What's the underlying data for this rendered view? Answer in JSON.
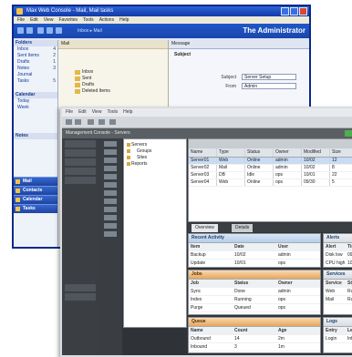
{
  "back_window": {
    "title": "Max Web Console - Mail, Mail tasks",
    "menu": [
      "File",
      "Edit",
      "View",
      "Favorites",
      "Tools",
      "Actions",
      "Help"
    ],
    "breadcrumb": "Inbox ▸ Mail",
    "brand": "The Administrator",
    "nav": {
      "header": "Folders",
      "rows": [
        {
          "label": "Inbox",
          "count": "4"
        },
        {
          "label": "Sent Items",
          "count": "2"
        },
        {
          "label": "Drafts",
          "count": "1"
        },
        {
          "label": "Notes",
          "count": "3"
        },
        {
          "label": "Journal",
          "count": ""
        },
        {
          "label": "Tasks",
          "count": "5"
        }
      ],
      "section2_header": "Calendar",
      "section2_rows": [
        "Today",
        "Week"
      ],
      "section3_header": "Notes",
      "buttons": [
        "Mail",
        "Contacts",
        "Calendar",
        "Tasks"
      ]
    },
    "mid": {
      "header": "Mail",
      "folders": [
        "Inbox",
        "Sent",
        "Drafts",
        "Deleted Items"
      ]
    },
    "right": {
      "header": "Message",
      "toolbar_label": "Subject",
      "fields": [
        {
          "label": "Subject",
          "value": "Server Setup"
        },
        {
          "label": "From",
          "value": "Admin"
        }
      ]
    }
  },
  "front_window": {
    "menu": [
      "File",
      "Edit",
      "View",
      "Tools",
      "Help"
    ],
    "address": "Management Console - Servers",
    "tree": [
      "Servers",
      "Groups",
      "Sites",
      "Reports"
    ],
    "detail_columns": [
      "Name",
      "Type",
      "Status",
      "Owner",
      "Modified",
      "Size"
    ],
    "detail_rows": [
      [
        "Server01",
        "Web",
        "Online",
        "admin",
        "10/02",
        "12"
      ],
      [
        "Server02",
        "Mail",
        "Online",
        "admin",
        "10/02",
        "8"
      ],
      [
        "Server03",
        "DB",
        "Idle",
        "ops",
        "10/01",
        "22"
      ],
      [
        "Server04",
        "Web",
        "Online",
        "ops",
        "09/30",
        "5"
      ]
    ],
    "tabs": [
      "Overview",
      "Details"
    ],
    "panels": [
      {
        "title": "Recent Activity",
        "rows": [
          [
            "Item",
            "Date",
            "User"
          ],
          [
            "Backup",
            "10/02",
            "admin"
          ],
          [
            "Update",
            "10/01",
            "ops"
          ]
        ]
      },
      {
        "title": "Alerts",
        "rows": [
          [
            "Alert",
            "Time"
          ],
          [
            "Disk low",
            "09:12"
          ],
          [
            "CPU high",
            "10:40"
          ]
        ]
      },
      {
        "title": "Jobs",
        "rows": [
          [
            "Job",
            "Status",
            "Owner"
          ],
          [
            "Sync",
            "Done",
            "admin"
          ],
          [
            "Index",
            "Running",
            "ops"
          ],
          [
            "Purge",
            "Queued",
            "ops"
          ]
        ]
      },
      {
        "title": "Services",
        "rows": [
          [
            "Service",
            "State"
          ],
          [
            "Web",
            "Running"
          ],
          [
            "Mail",
            "Running"
          ]
        ]
      },
      {
        "title": "Queue",
        "rows": [
          [
            "Name",
            "Count",
            "Age"
          ],
          [
            "Outbound",
            "14",
            "2m"
          ],
          [
            "Inbound",
            "3",
            "1m"
          ]
        ]
      },
      {
        "title": "Logs",
        "rows": [
          [
            "Entry",
            "Level"
          ],
          [
            "Login",
            "Info"
          ]
        ]
      }
    ]
  }
}
